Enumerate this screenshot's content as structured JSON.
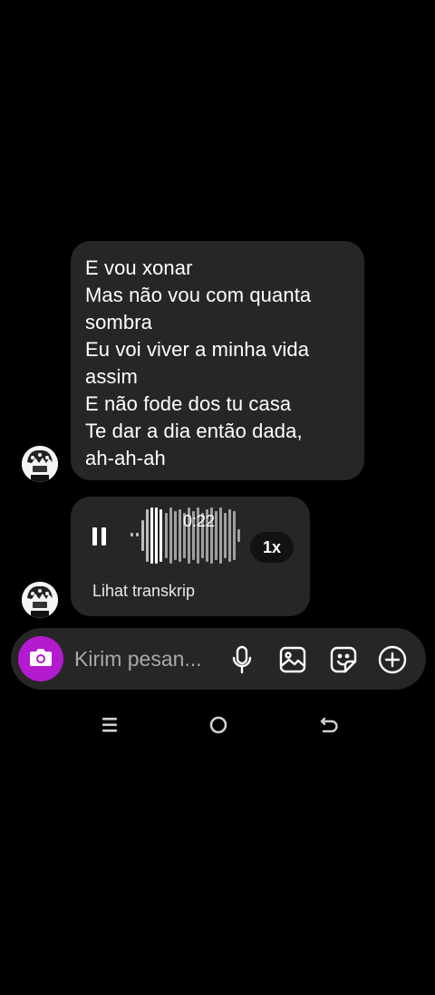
{
  "message_text": {
    "lines": [
      "E vou xonar",
      "Mas não vou com quanta",
      "sombra",
      "Eu voi viver a minha vida",
      "assim",
      "E não fode dos tu casa",
      "Te dar a dia então dada,",
      "ah-ah-ah"
    ]
  },
  "voice_message": {
    "state_icon": "pause-icon",
    "duration": "0:22",
    "speed": "1x",
    "transcript_link": "Lihat transkrip"
  },
  "composer": {
    "placeholder": "Kirim pesan...",
    "camera_color": "#b41ad0",
    "icons": [
      "camera-icon",
      "microphone-icon",
      "gallery-icon",
      "sticker-icon",
      "add-icon"
    ]
  },
  "system_nav": {
    "icons": [
      "recent-apps-icon",
      "home-icon",
      "back-icon"
    ]
  }
}
